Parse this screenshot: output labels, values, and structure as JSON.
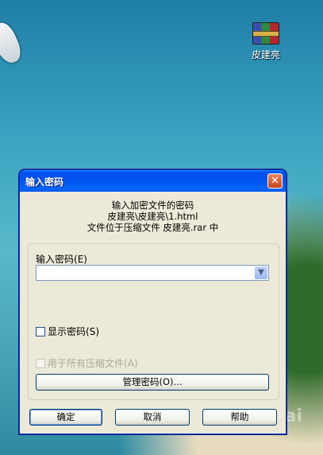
{
  "desktop": {
    "icon_label": "皮建亮",
    "watermark": "Bai"
  },
  "dialog": {
    "title": "输入密码",
    "close_glyph": "✕",
    "desc_line1": "输入加密文件的密码",
    "desc_line2": "皮建亮\\皮建亮\\1.html",
    "desc_line3": "文件位于压缩文件 皮建亮.rar 中",
    "password_label": "输入密码",
    "password_mnemonic": "(E)",
    "password_value": "",
    "show_password_label": "显示密码",
    "show_password_mnemonic": "(S)",
    "show_password_checked": false,
    "use_for_all_label": "用于所有压缩文件",
    "use_for_all_mnemonic": "(A)",
    "use_for_all_enabled": false,
    "manage_button": "管理密码(O)...",
    "ok_button": "确定",
    "cancel_button": "取消",
    "help_button": "帮助",
    "dropdown_glyph": "▼"
  },
  "colors": {
    "titlebar": "#0053ee",
    "dialog_bg": "#ece9d8",
    "close_button": "#c9421b"
  }
}
